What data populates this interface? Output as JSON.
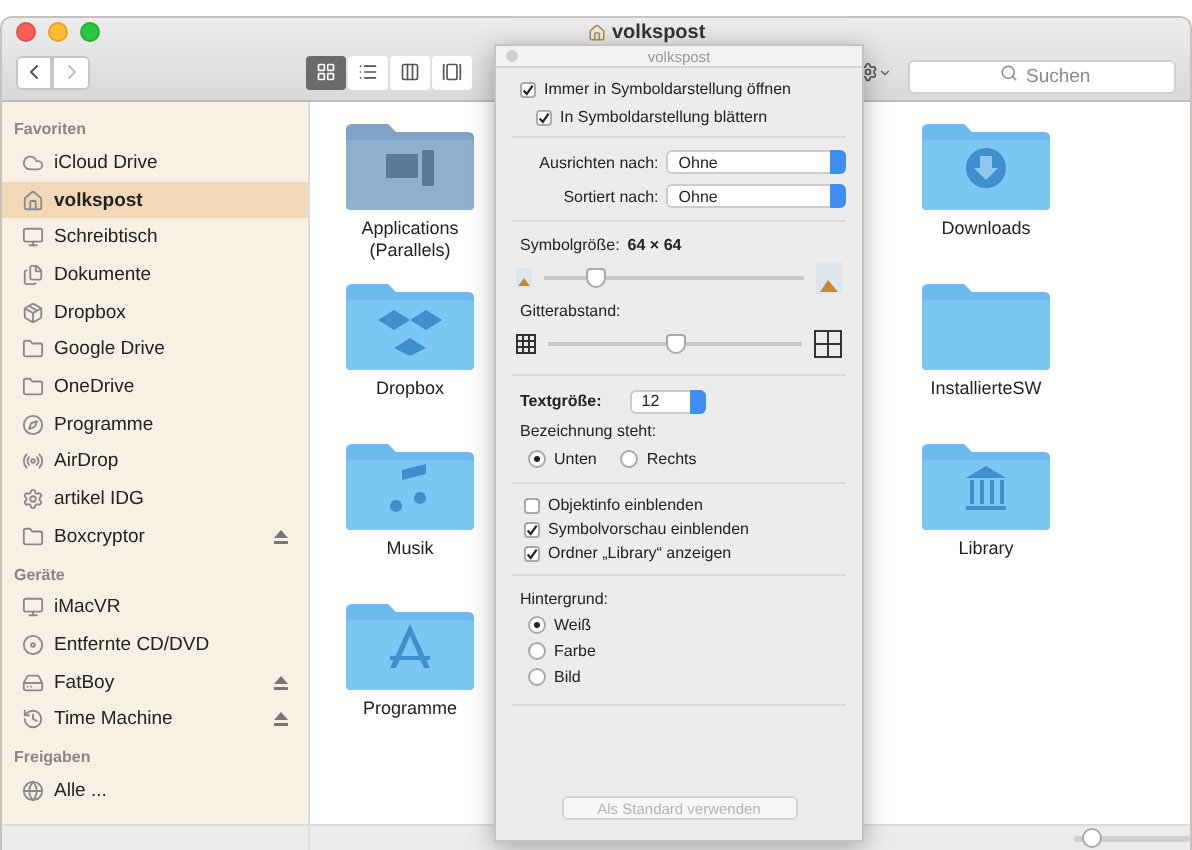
{
  "window": {
    "title": "volkspost"
  },
  "toolbar": {
    "view_modes": [
      {
        "kind": "icons",
        "selected": true
      },
      {
        "kind": "list",
        "selected": false
      },
      {
        "kind": "columns",
        "selected": false
      },
      {
        "kind": "coverflow",
        "selected": false
      }
    ],
    "search": {
      "placeholder": "Suchen"
    }
  },
  "sidebar": {
    "sections": [
      {
        "title": "Favoriten",
        "items": [
          {
            "label": "iCloud Drive",
            "kind": "cloud",
            "selected": false,
            "eject": false
          },
          {
            "label": "volkspost",
            "kind": "home",
            "selected": true,
            "eject": false
          },
          {
            "label": "Schreibtisch",
            "kind": "desktop",
            "selected": false,
            "eject": false
          },
          {
            "label": "Dokumente",
            "kind": "documents",
            "selected": false,
            "eject": false
          },
          {
            "label": "Dropbox",
            "kind": "dropbox",
            "selected": false,
            "eject": false
          },
          {
            "label": "Google Drive",
            "kind": "folder",
            "selected": false,
            "eject": false
          },
          {
            "label": "OneDrive",
            "kind": "folder",
            "selected": false,
            "eject": false
          },
          {
            "label": "Programme",
            "kind": "apps",
            "selected": false,
            "eject": false
          },
          {
            "label": "AirDrop",
            "kind": "airdrop",
            "selected": false,
            "eject": false
          },
          {
            "label": "artikel IDG",
            "kind": "gear",
            "selected": false,
            "eject": false
          },
          {
            "label": "Boxcryptor",
            "kind": "folder",
            "selected": false,
            "eject": true
          }
        ]
      },
      {
        "title": "Geräte",
        "items": [
          {
            "label": "iMacVR",
            "kind": "imac",
            "selected": false,
            "eject": false
          },
          {
            "label": "Entfernte CD/DVD",
            "kind": "disc",
            "selected": false,
            "eject": false
          },
          {
            "label": "FatBoy",
            "kind": "drive",
            "selected": false,
            "eject": true
          },
          {
            "label": "Time Machine",
            "kind": "timemachine",
            "selected": false,
            "eject": true
          }
        ]
      },
      {
        "title": "Freigaben",
        "items": [
          {
            "label": "Alle ...",
            "kind": "network",
            "selected": false,
            "eject": false
          }
        ]
      }
    ]
  },
  "content": {
    "columns": [
      [
        {
          "label": "Applications (Parallels)",
          "kind": "apps_gray"
        },
        {
          "label": "Dropbox",
          "kind": "dropbox"
        },
        {
          "label": "Musik",
          "kind": "music"
        },
        {
          "label": "Programme",
          "kind": "appstore"
        }
      ],
      [
        {
          "label": "Downloads",
          "kind": "download"
        },
        {
          "label": "InstallierteSW",
          "kind": "plain"
        },
        {
          "label": "Library",
          "kind": "library"
        }
      ]
    ]
  },
  "view_options": {
    "title": "volkspost",
    "open_options": [
      {
        "label": "Immer in Symboldarstellung öffnen",
        "checked": true
      },
      {
        "label": "In Symboldarstellung blättern",
        "checked": true
      }
    ],
    "popups": [
      {
        "label": "Ausrichten nach:",
        "value": "Ohne"
      },
      {
        "label": "Sortiert nach:",
        "value": "Ohne"
      }
    ],
    "icon_size": {
      "label": "Symbolgröße:",
      "value": "64 × 64",
      "level": 0.2
    },
    "grid_spacing": {
      "label": "Gitterabstand:",
      "level": 0.5
    },
    "text_size": {
      "label": "Textgröße:",
      "value": "12"
    },
    "label_position": {
      "label": "Bezeichnung steht:",
      "options": [
        {
          "label": "Unten",
          "selected": true
        },
        {
          "label": "Rechts",
          "selected": false
        }
      ]
    },
    "display_options": [
      {
        "label": "Objektinfo einblenden",
        "checked": false
      },
      {
        "label": "Symbolvorschau einblenden",
        "checked": true
      },
      {
        "label": "Ordner „Library“ anzeigen",
        "checked": true
      }
    ],
    "background": {
      "label": "Hintergrund:",
      "options": [
        {
          "label": "Weiß",
          "selected": true
        },
        {
          "label": "Farbe",
          "selected": false
        },
        {
          "label": "Bild",
          "selected": false
        }
      ]
    },
    "default_button": {
      "label": "Als Standard verwenden",
      "disabled": true
    }
  },
  "status_bar": {
    "zoom": {
      "level": 0.15
    }
  }
}
